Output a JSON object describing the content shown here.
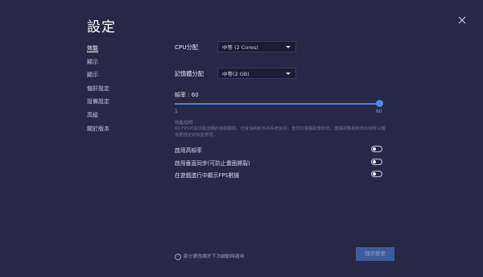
{
  "title": "設定",
  "sidebar": {
    "items": [
      {
        "label": "效能",
        "active": true
      },
      {
        "label": "顯示",
        "active": false
      },
      {
        "label": "顯示",
        "active": false
      },
      {
        "label": "偏好設定",
        "active": false
      },
      {
        "label": "設備設定",
        "active": false
      },
      {
        "label": "高級",
        "active": false
      },
      {
        "label": "關於版本",
        "active": false
      }
    ]
  },
  "performance": {
    "cpu_label": "CPU分配",
    "cpu_value": "中等 (2 Cores)",
    "memory_label": "記憶體分配",
    "memory_value": "中等(2 GB)",
    "fps_label": "幀率 : 60",
    "fps_min": "1",
    "fps_max": "60",
    "fps_value": 60,
    "note_title": "效能說明",
    "note_body": "60 FPS可提供最流暢的遊戲體驗，但會消耗較多的系統資源；若您的電腦配置較低，建議調整為較低的幀率以獲得更穩定的效能表現。",
    "options": [
      {
        "label": "啟用高幀率",
        "enabled": false
      },
      {
        "label": "啟用垂直同步(可防止畫面撕裂)",
        "enabled": false
      },
      {
        "label": "在遊戲進行中顯示FPS數據",
        "enabled": false
      }
    ]
  },
  "footer": {
    "note": "部分更改將於下次啟動時適用",
    "save_label": "儲存變更"
  },
  "colors": {
    "background": "#272845",
    "accent": "#4a80e8",
    "button": "#3e5b9a"
  }
}
